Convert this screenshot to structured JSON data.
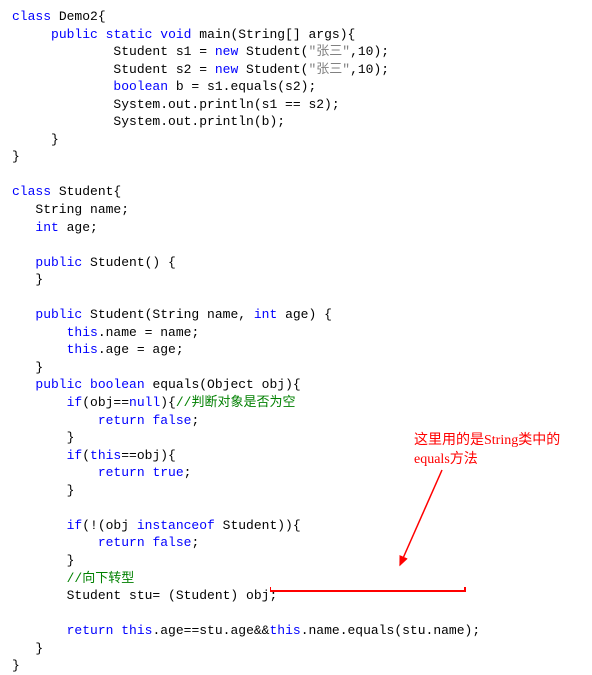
{
  "code": {
    "l1_kw": "class",
    "l1_rest": " Demo2{",
    "l2_pre": "     ",
    "l2_kw1": "public",
    "l2_mid1": " ",
    "l2_kw2": "static",
    "l2_mid2": " ",
    "l2_kw3": "void",
    "l2_rest": " main(String[] args){",
    "l3_pre": "             Student s1 = ",
    "l3_kw": "new",
    "l3_mid": " Student(",
    "l3_str": "\"张三\"",
    "l3_rest": ",10);",
    "l4_pre": "             Student s2 = ",
    "l4_kw": "new",
    "l4_mid": " Student(",
    "l4_str": "\"张三\"",
    "l4_rest": ",10);",
    "l5_pre": "             ",
    "l5_kw": "boolean",
    "l5_rest": " b = s1.equals(s2);",
    "l6": "             System.out.println(s1 == s2);",
    "l7": "             System.out.println(b);",
    "l8": "     }",
    "l9": "}",
    "l10": "",
    "l11_kw": "class",
    "l11_rest": " Student{",
    "l12": "   String name;",
    "l13_pre": "   ",
    "l13_kw": "int",
    "l13_rest": " age;",
    "l14": "",
    "l15_pre": "   ",
    "l15_kw": "public",
    "l15_rest": " Student() {",
    "l16": "   }",
    "l17": "",
    "l18_pre": "   ",
    "l18_kw": "public",
    "l18_mid": " Student(String name, ",
    "l18_kw2": "int",
    "l18_rest": " age) {",
    "l19_pre": "       ",
    "l19_kw": "this",
    "l19_rest": ".name = name;",
    "l20_pre": "       ",
    "l20_kw": "this",
    "l20_rest": ".age = age;",
    "l21": "   }",
    "l22_pre": "   ",
    "l22_kw1": "public",
    "l22_mid": " ",
    "l22_kw2": "boolean",
    "l22_rest": " equals(Object obj){",
    "l23_pre": "       ",
    "l23_kw": "if",
    "l23_mid": "(obj==",
    "l23_kw2": "null",
    "l23_mid2": "){",
    "l23_cmt": "//判断对象是否为空",
    "l24_pre": "           ",
    "l24_kw": "return",
    "l24_mid": " ",
    "l24_kw2": "false",
    "l24_rest": ";",
    "l25": "       }",
    "l26_pre": "       ",
    "l26_kw": "if",
    "l26_mid": "(",
    "l26_kw2": "this",
    "l26_rest": "==obj){",
    "l27_pre": "           ",
    "l27_kw": "return",
    "l27_mid": " ",
    "l27_kw2": "true",
    "l27_rest": ";",
    "l28": "       }",
    "l29": "",
    "l30_pre": "       ",
    "l30_kw": "if",
    "l30_mid": "(!(obj ",
    "l30_kw2": "instanceof",
    "l30_rest": " Student)){",
    "l31_pre": "           ",
    "l31_kw": "return",
    "l31_mid": " ",
    "l31_kw2": "false",
    "l31_rest": ";",
    "l32": "       }",
    "l33_pre": "       ",
    "l33_cmt": "//向下转型",
    "l34": "       Student stu= (Student) obj;",
    "l35": "",
    "l36_pre": "       ",
    "l36_kw": "return",
    "l36_mid": " ",
    "l36_kw2": "this",
    "l36_mid2": ".age==stu.age&&",
    "l36_kw3": "this",
    "l36_rest": ".name.equals(stu.name);",
    "l37": "   }",
    "l38": "}"
  },
  "annotation": {
    "line1": "这里用的是String类中的",
    "line2": "equals方法"
  }
}
